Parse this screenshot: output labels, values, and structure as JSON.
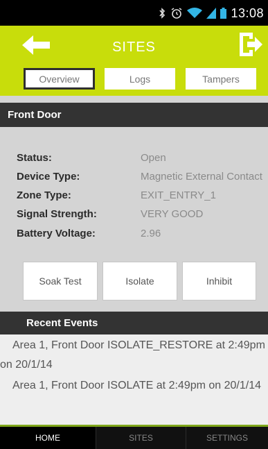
{
  "status_bar": {
    "time": "13:08",
    "icons": [
      "bluetooth-icon",
      "alarm-icon",
      "wifi-icon",
      "signal-icon",
      "battery-icon"
    ]
  },
  "header": {
    "title": "SITES",
    "back_icon": "back-arrow-icon",
    "exit_icon": "exit-icon",
    "accent_color": "#c8dd0b"
  },
  "tabs": [
    {
      "label": "Overview",
      "selected": true
    },
    {
      "label": "Logs",
      "selected": false
    },
    {
      "label": "Tampers",
      "selected": false
    }
  ],
  "device": {
    "name": "Front Door",
    "fields": [
      {
        "label": "Status:",
        "value": "Open"
      },
      {
        "label": "Device Type:",
        "value": "Magnetic External Contact"
      },
      {
        "label": "Zone Type:",
        "value": "EXIT_ENTRY_1"
      },
      {
        "label": "Signal Strength:",
        "value": "VERY GOOD"
      },
      {
        "label": "Battery Voltage:",
        "value": "2.96"
      }
    ]
  },
  "actions": [
    {
      "label": "Soak Test"
    },
    {
      "label": "Isolate"
    },
    {
      "label": "Inhibit"
    }
  ],
  "recent_events": {
    "title": "Recent Events",
    "items": [
      "Area 1, Front Door ISOLATE_RESTORE at 2:49pm on 20/1/14",
      "Area 1, Front Door ISOLATE at 2:49pm on 20/1/14"
    ]
  },
  "bottom_nav": [
    {
      "label": "HOME",
      "active": true
    },
    {
      "label": "SITES",
      "active": false
    },
    {
      "label": "SETTINGS",
      "active": false
    }
  ]
}
